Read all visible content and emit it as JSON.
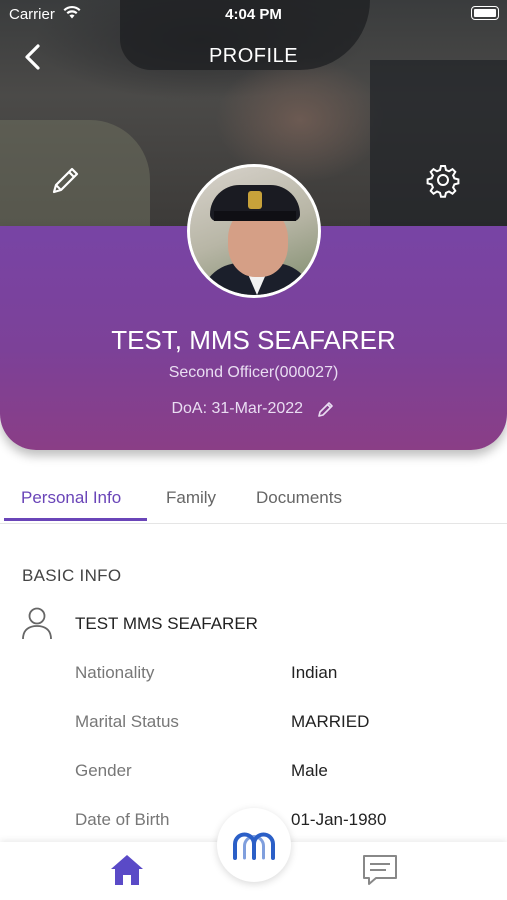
{
  "status_bar": {
    "carrier": "Carrier",
    "time": "4:04 PM"
  },
  "nav": {
    "title": "PROFILE",
    "icons": {
      "back": "chevron-left-icon",
      "edit": "pencil-icon",
      "settings": "gear-icon"
    }
  },
  "profile": {
    "name": "TEST, MMS SEAFARER",
    "rank": "Second Officer(000027)",
    "doa": "DoA: 31-Mar-2022"
  },
  "tabs": [
    {
      "label": "Personal Info",
      "active": true
    },
    {
      "label": "Family",
      "active": false
    },
    {
      "label": "Documents",
      "active": false
    }
  ],
  "basic_info": {
    "section_title": "BASIC INFO",
    "full_name": "TEST MMS SEAFARER",
    "rows": [
      {
        "label": "Nationality",
        "value": "Indian"
      },
      {
        "label": "Marital Status",
        "value": "MARRIED"
      },
      {
        "label": "Gender",
        "value": "Male"
      },
      {
        "label": "Date of Birth",
        "value": "01-Jan-1980"
      }
    ]
  },
  "bottom_bar": {
    "icons": {
      "home": "home-icon",
      "center": "logo-icon",
      "chat": "chat-icon"
    }
  },
  "colors": {
    "accent": "#6a45b8",
    "card_top": "#7844a5",
    "card_bottom": "#8a3e86",
    "home_icon": "#5a4ac7"
  }
}
